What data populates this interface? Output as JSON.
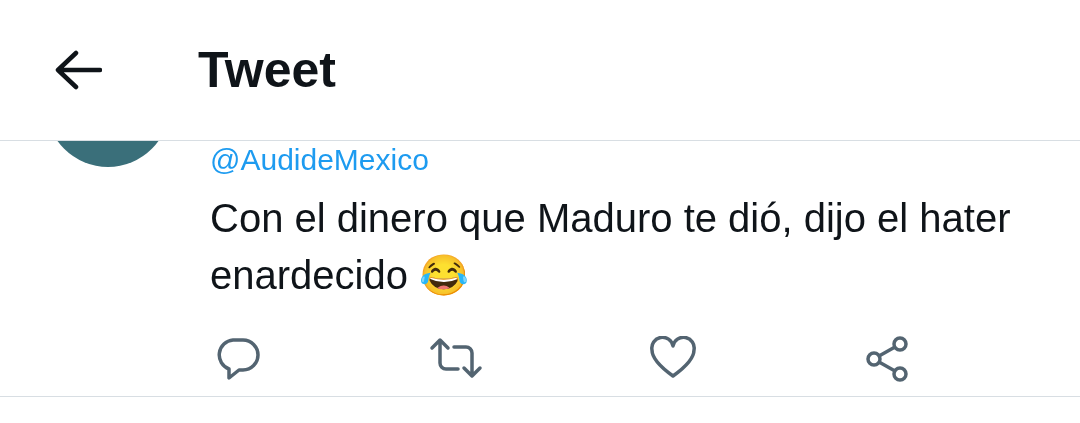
{
  "header": {
    "title": "Tweet"
  },
  "tweet": {
    "handle": "@AudideMexico",
    "text": "Con el dinero que Maduro te dió, dijo el hater enardecido 😂"
  }
}
